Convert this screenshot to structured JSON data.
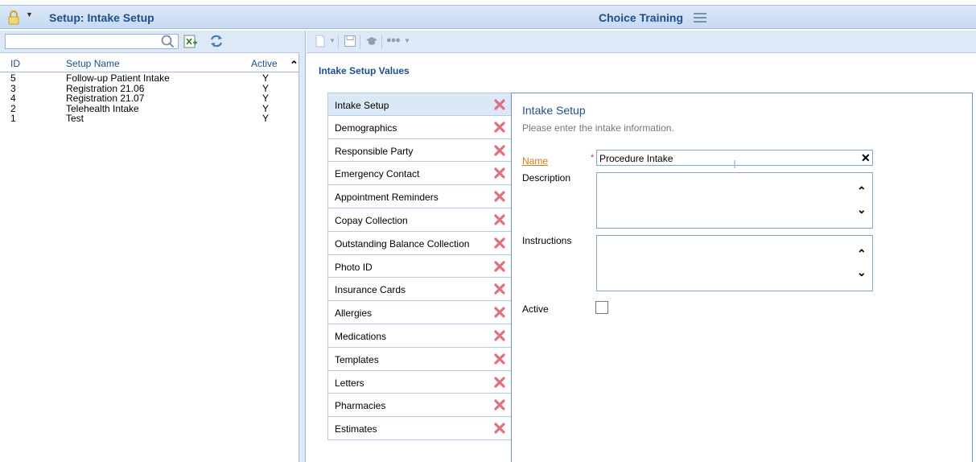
{
  "header": {
    "title": "Setup: Intake Setup",
    "user": "Choice Training"
  },
  "left": {
    "search": {
      "value": "",
      "placeholder": ""
    },
    "columns": {
      "id": "ID",
      "name": "Setup Name",
      "active": "Active"
    },
    "rows": [
      {
        "id": "5",
        "name": "Follow-up Patient Intake",
        "active": "Y"
      },
      {
        "id": "3",
        "name": "Registration 21.06",
        "active": "Y"
      },
      {
        "id": "4",
        "name": "Registration 21.07",
        "active": "Y"
      },
      {
        "id": "2",
        "name": "Telehealth Intake",
        "active": "Y"
      },
      {
        "id": "1",
        "name": "Test",
        "active": "Y"
      }
    ]
  },
  "main": {
    "section_title": "Intake Setup Values",
    "tabs": [
      {
        "label": "Intake Setup"
      },
      {
        "label": "Demographics"
      },
      {
        "label": "Responsible Party"
      },
      {
        "label": "Emergency Contact"
      },
      {
        "label": "Appointment Reminders"
      },
      {
        "label": "Copay Collection"
      },
      {
        "label": "Outstanding Balance Collection"
      },
      {
        "label": "Photo ID"
      },
      {
        "label": "Insurance Cards"
      },
      {
        "label": "Allergies"
      },
      {
        "label": "Medications"
      },
      {
        "label": "Templates"
      },
      {
        "label": "Letters"
      },
      {
        "label": "Pharmacies"
      },
      {
        "label": "Estimates"
      }
    ],
    "form": {
      "title": "Intake Setup",
      "subtitle": "Please enter the intake information.",
      "name_label": "Name",
      "name_required": "*",
      "name_value": "Procedure Intake",
      "description_label": "Description",
      "instructions_label": "Instructions",
      "active_label": "Active"
    }
  },
  "colors": {
    "accent": "#1f4e8a",
    "toolbar_bg": "#dde9f7",
    "link": "#d77a1a",
    "remove": "#e07080"
  }
}
